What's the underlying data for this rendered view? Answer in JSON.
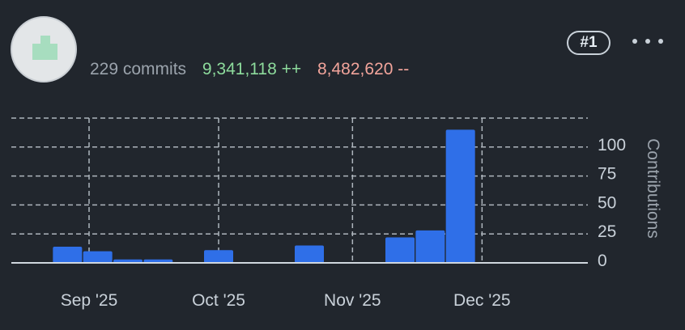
{
  "contributor": {
    "avatar_icon": "identicon",
    "commits_label": "229 commits",
    "additions_label": "9,341,118 ++",
    "deletions_label": "8,482,620 --",
    "rank_label": "#1",
    "menu_icon": "kebab-horizontal-icon"
  },
  "colors": {
    "background": "#21262d",
    "bar": "#2f6fe8",
    "grid": "#aeb5bd",
    "additions": "#8ddb9c",
    "deletions": "#f2a49b",
    "axis_text": "#c9d1d9"
  },
  "chart_data": {
    "type": "bar",
    "title": "",
    "xlabel": "",
    "ylabel": "Contributions",
    "ylim": [
      0,
      125
    ],
    "yticks": [
      0,
      25,
      50,
      75,
      100
    ],
    "grid": true,
    "x_axis": "time",
    "bin": "week",
    "x_ticks": [
      "Sep '25",
      "Oct '25",
      "Nov '25",
      "Dec '25"
    ],
    "series": [
      {
        "values": [
          {
            "week": "2025-08-27",
            "value": 14
          },
          {
            "week": "2025-09-03",
            "value": 10
          },
          {
            "week": "2025-09-10",
            "value": 3
          },
          {
            "week": "2025-09-17",
            "value": 3
          },
          {
            "week": "2025-10-01",
            "value": 11
          },
          {
            "week": "2025-10-22",
            "value": 15
          },
          {
            "week": "2025-11-12",
            "value": 22
          },
          {
            "week": "2025-11-19",
            "value": 28
          },
          {
            "week": "2025-11-26",
            "value": 115
          }
        ]
      }
    ]
  }
}
